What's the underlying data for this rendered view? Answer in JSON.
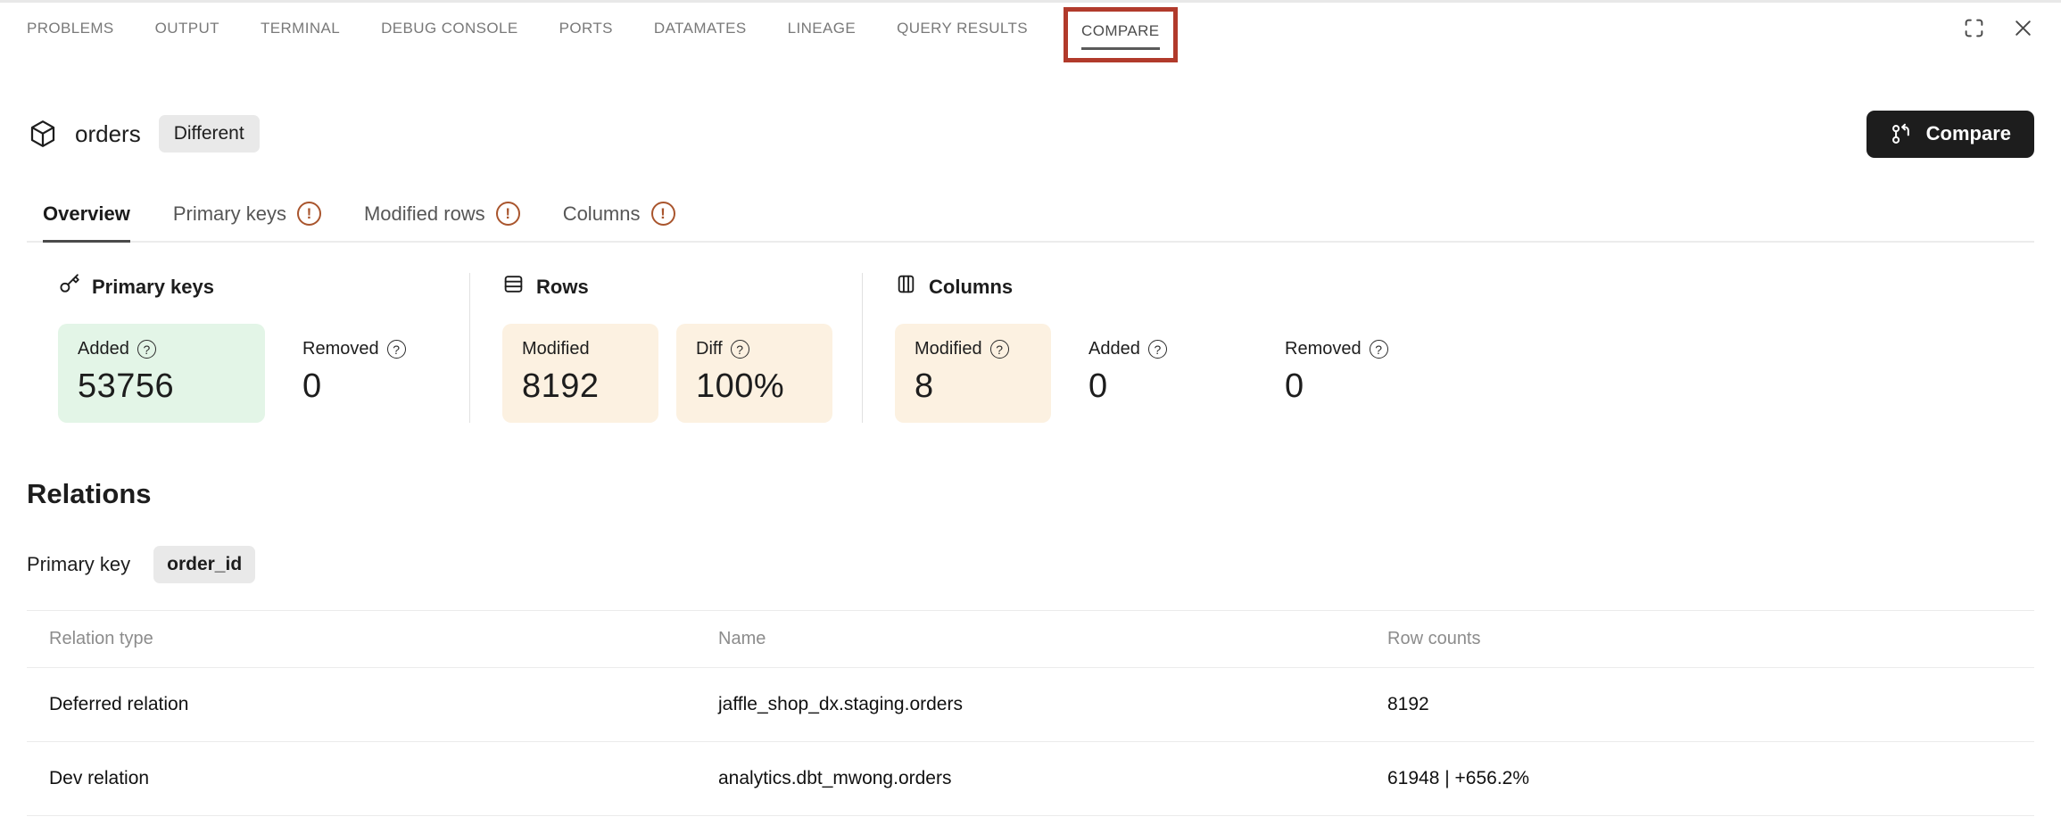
{
  "panel": {
    "tabs": [
      {
        "label": "PROBLEMS",
        "active": false
      },
      {
        "label": "OUTPUT",
        "active": false
      },
      {
        "label": "TERMINAL",
        "active": false
      },
      {
        "label": "DEBUG CONSOLE",
        "active": false
      },
      {
        "label": "PORTS",
        "active": false
      },
      {
        "label": "DATAMATES",
        "active": false
      },
      {
        "label": "LINEAGE",
        "active": false
      },
      {
        "label": "QUERY RESULTS",
        "active": false
      },
      {
        "label": "COMPARE",
        "active": true,
        "annotated": true
      }
    ],
    "actions": [
      {
        "icon": "maximize-panel-icon"
      },
      {
        "icon": "close-panel-icon"
      }
    ]
  },
  "header": {
    "model_icon": "package-cube-icon",
    "model_name": "orders",
    "status_badge": "Different",
    "compare_button": "Compare",
    "compare_button_icon": "git-compare-icon"
  },
  "view_tabs": [
    {
      "label": "Overview",
      "active": true,
      "warning": false
    },
    {
      "label": "Primary keys",
      "active": false,
      "warning": true
    },
    {
      "label": "Modified rows",
      "active": false,
      "warning": true
    },
    {
      "label": "Columns",
      "active": false,
      "warning": true
    }
  ],
  "stats_groups": [
    {
      "title": "Primary keys",
      "icon": "key-icon",
      "metrics": [
        {
          "label": "Added",
          "help": true,
          "value": "53756",
          "highlight": "green"
        },
        {
          "label": "Removed",
          "help": true,
          "value": "0",
          "highlight": "none"
        }
      ]
    },
    {
      "title": "Rows",
      "icon": "rows-icon",
      "metrics": [
        {
          "label": "Modified",
          "help": false,
          "value": "8192",
          "highlight": "orange"
        },
        {
          "label": "Diff",
          "help": true,
          "value": "100%",
          "highlight": "orange"
        }
      ]
    },
    {
      "title": "Columns",
      "icon": "columns-icon",
      "metrics": [
        {
          "label": "Modified",
          "help": true,
          "value": "8",
          "highlight": "orange"
        },
        {
          "label": "Added",
          "help": true,
          "value": "0",
          "highlight": "none"
        },
        {
          "label": "Removed",
          "help": true,
          "value": "0",
          "highlight": "none"
        }
      ]
    }
  ],
  "relations": {
    "title": "Relations",
    "primary_key_label": "Primary key",
    "primary_key_value": "order_id",
    "table": {
      "headers": [
        "Relation type",
        "Name",
        "Row counts"
      ],
      "rows": [
        {
          "relation_type": "Deferred relation",
          "name": "jaffle_shop_dx.staging.orders",
          "row_counts": "8192"
        },
        {
          "relation_type": "Dev relation",
          "name": "analytics.dbt_mwong.orders",
          "row_counts": "61948 | +656.2%"
        }
      ]
    }
  },
  "colors": {
    "green_bg": "#e3f5e7",
    "orange_bg": "#fcf1e1",
    "warning_icon": "#a9552d",
    "annotation_red": "#b13a2b",
    "badge_bg": "#e9e9e9",
    "button_bg": "#1d1d1d"
  }
}
